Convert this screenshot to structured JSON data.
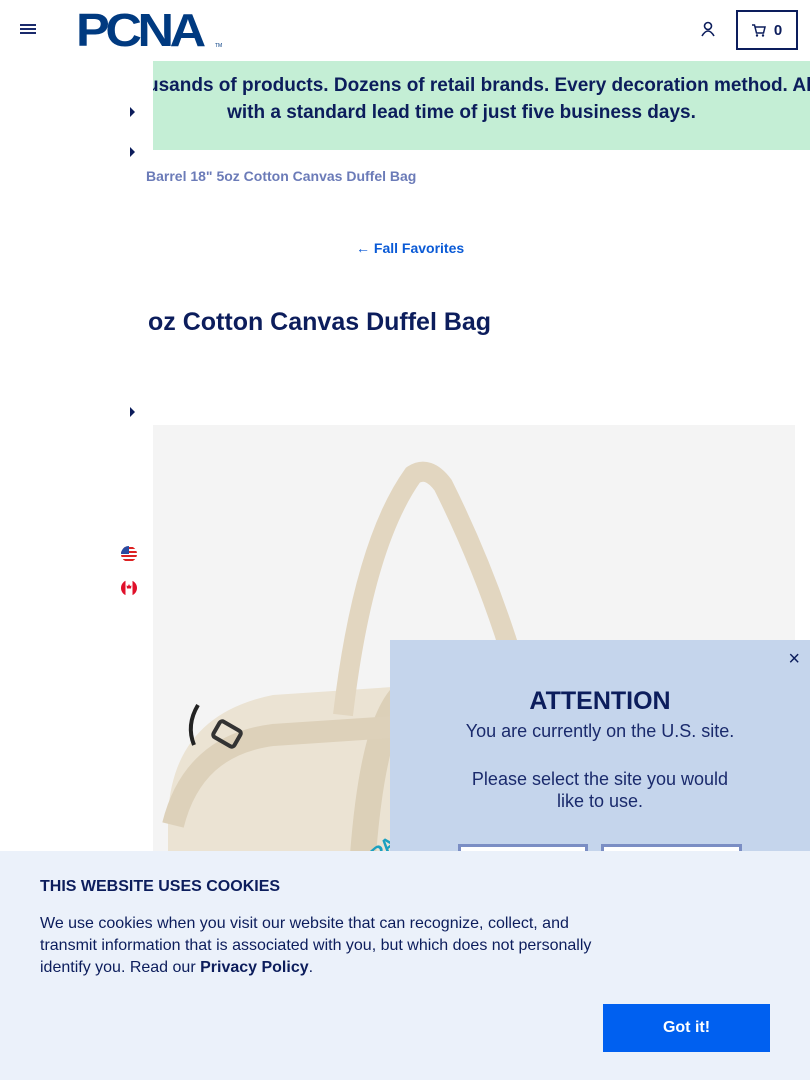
{
  "header": {
    "logo": "PCNA",
    "logo_tm": "TM",
    "cart_count": "0",
    "icons": [
      "menu-icon",
      "user-icon",
      "cart-icon"
    ]
  },
  "promo": {
    "line1": "usands of products. Dozens of retail brands. Every decoration method. All",
    "line2": "with a standard lead time of just five business days."
  },
  "breadcrumb": {
    "current": "Barrel 18\" 5oz Cotton Canvas Duffel Bag"
  },
  "back_link": "← Fall Favorites",
  "product": {
    "title": "oz Cotton Canvas Duffel Bag"
  },
  "modal": {
    "close": "×",
    "title": "ATTENTION",
    "line1": "You are currently on the U.S. site.",
    "line2": "Please select the site you would like to use."
  },
  "cookies": {
    "title": "THIS WEBSITE USES COOKIES",
    "text": "We use cookies when you visit our website that can recognize, collect, and transmit information that is associated with you, but which does not personally identify you. Read our ",
    "link": "Privacy Policy",
    "text_end": ".",
    "button": "Got it!"
  },
  "colors": {
    "navy": "#0c1d5c",
    "promo_bg": "#c4eed5",
    "modal_bg": "#c5d5ec",
    "cookie_bg": "#ebf1fa",
    "button": "#0060f0"
  }
}
